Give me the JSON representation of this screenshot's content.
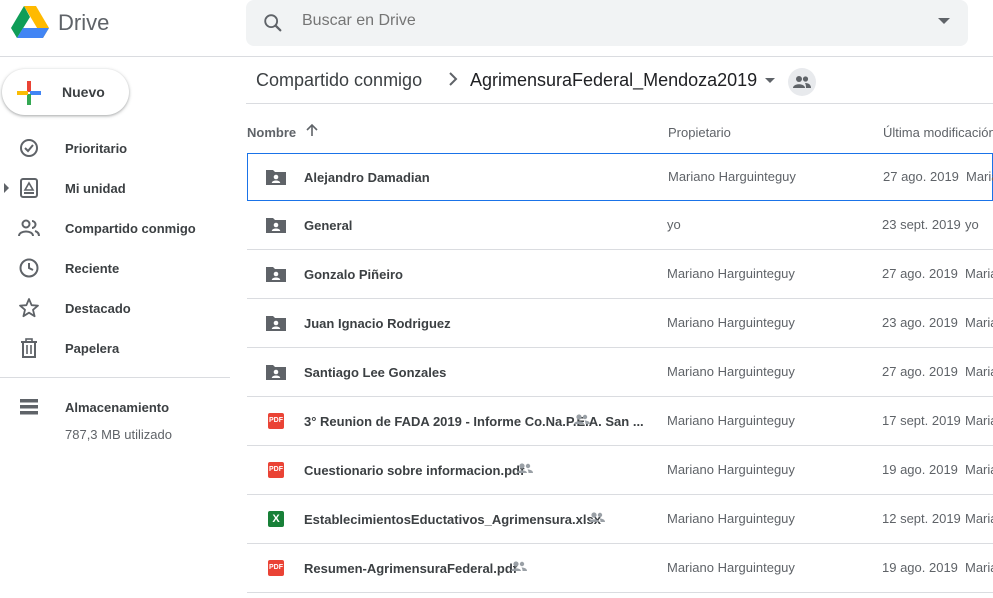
{
  "app": {
    "name": "Drive"
  },
  "search": {
    "placeholder": "Buscar en Drive"
  },
  "new_button": {
    "label": "Nuevo"
  },
  "sidebar": {
    "items": [
      {
        "label": "Prioritario",
        "icon": "checkbox-icon"
      },
      {
        "label": "Mi unidad",
        "icon": "my-drive-icon"
      },
      {
        "label": "Compartido conmigo",
        "icon": "people-icon"
      },
      {
        "label": "Reciente",
        "icon": "clock-icon"
      },
      {
        "label": "Destacado",
        "icon": "star-icon"
      },
      {
        "label": "Papelera",
        "icon": "trash-icon"
      }
    ],
    "storage": {
      "title": "Almacenamiento",
      "used": "787,3 MB utilizado"
    }
  },
  "breadcrumb": {
    "parent": "Compartido conmigo",
    "current": "AgrimensuraFederal_Mendoza2019"
  },
  "table": {
    "headers": {
      "name": "Nombre",
      "owner": "Propietario",
      "modified": "Última modificación"
    },
    "rows": [
      {
        "name": "Alejandro Damadian",
        "type": "shared-folder",
        "shared": false,
        "owner": "Mariano Harguinteguy",
        "modified": "27 ago. 2019",
        "by": "Mariano Harguinteguy"
      },
      {
        "name": "General",
        "type": "shared-folder",
        "shared": false,
        "owner": "yo",
        "modified": "23 sept. 2019",
        "by": "yo"
      },
      {
        "name": "Gonzalo Piñeiro",
        "type": "shared-folder",
        "shared": false,
        "owner": "Mariano Harguinteguy",
        "modified": "27 ago. 2019",
        "by": "Mariano Harguinteguy"
      },
      {
        "name": "Juan Ignacio Rodriguez",
        "type": "shared-folder",
        "shared": false,
        "owner": "Mariano Harguinteguy",
        "modified": "23 ago. 2019",
        "by": "Mariano Harguinteguy"
      },
      {
        "name": "Santiago Lee Gonzales",
        "type": "shared-folder",
        "shared": false,
        "owner": "Mariano Harguinteguy",
        "modified": "27 ago. 2019",
        "by": "Mariano Harguinteguy"
      },
      {
        "name": "3° Reunion de FADA 2019 - Informe Co.Na.P.E.A. San ...",
        "type": "pdf",
        "shared": true,
        "owner": "Mariano Harguinteguy",
        "modified": "17 sept. 2019",
        "by": "Mariano Harguinteguy"
      },
      {
        "name": "Cuestionario sobre informacion.pdf",
        "type": "pdf",
        "shared": true,
        "owner": "Mariano Harguinteguy",
        "modified": "19 ago. 2019",
        "by": "Mariano Harguinteguy"
      },
      {
        "name": "EstablecimientosEductativos_Agrimensura.xlsx",
        "type": "xlsx",
        "shared": true,
        "owner": "Mariano Harguinteguy",
        "modified": "12 sept. 2019",
        "by": "Mariano Harguinteguy"
      },
      {
        "name": "Resumen-AgrimensuraFederal.pdf",
        "type": "pdf",
        "shared": true,
        "owner": "Mariano Harguinteguy",
        "modified": "19 ago. 2019",
        "by": "Mariano Harguinteguy"
      }
    ]
  },
  "colors": {
    "accent": "#1a73e8",
    "pdf": "#ea4335",
    "sheet": "#188038",
    "folder": "#5f6368"
  }
}
